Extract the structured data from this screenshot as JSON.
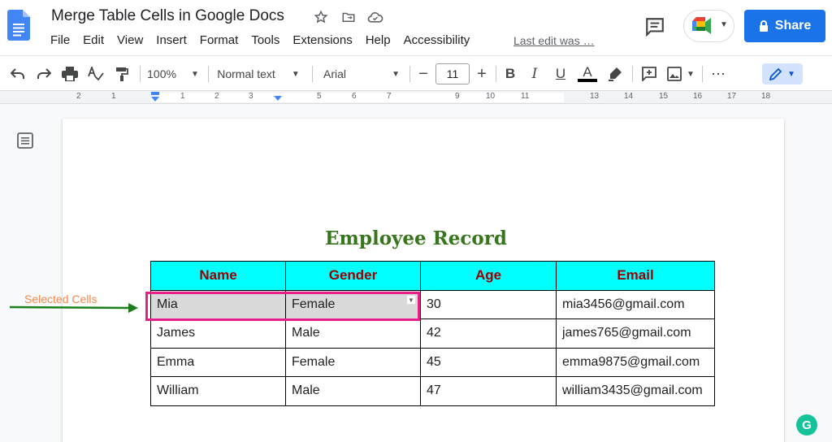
{
  "app": {
    "title": "Merge Table Cells in Google Docs",
    "menu": [
      "File",
      "Edit",
      "View",
      "Insert",
      "Format",
      "Tools",
      "Extensions",
      "Help",
      "Accessibility"
    ],
    "last_edit": "Last edit was …",
    "share_label": "Share",
    "accent_color": "#1a73e8"
  },
  "toolbar": {
    "zoom": "100%",
    "style": "Normal text",
    "font": "Arial",
    "font_size": "11",
    "minus": "−",
    "plus": "+",
    "bold": "B",
    "italic": "I",
    "underline": "U",
    "text_color": "A",
    "more": "⋯"
  },
  "ruler": {
    "labels": [
      "2",
      "1",
      "1",
      "2",
      "3",
      "5",
      "6",
      "7",
      "9",
      "10",
      "11",
      "13",
      "14",
      "15",
      "16",
      "17",
      "18"
    ]
  },
  "document": {
    "heading": "Employee Record",
    "table": {
      "headers": [
        "Name",
        "Gender",
        "Age",
        "Email"
      ],
      "rows": [
        [
          "Mia",
          "Female",
          "30",
          "mia3456@gmail.com"
        ],
        [
          "James",
          "Male",
          "42",
          "james765@gmail.com"
        ],
        [
          "Emma",
          "Female",
          "45",
          "emma9875@gmail.com"
        ],
        [
          "William",
          "Male",
          "47",
          "william3435@gmail.com"
        ]
      ]
    }
  },
  "annotation": {
    "label": "Selected Cells",
    "color": "#f4894d",
    "arrow_color": "#1a7f1a",
    "highlight_color": "#e91e8c"
  },
  "grammarly": "G"
}
